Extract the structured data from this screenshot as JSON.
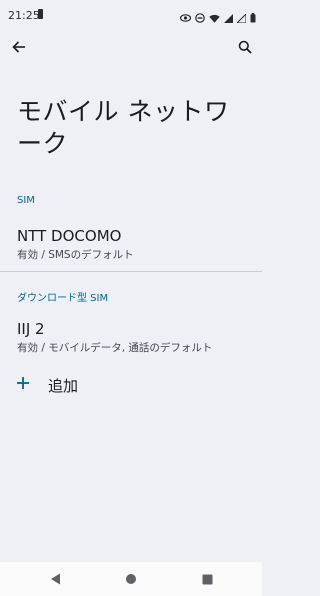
{
  "status_bar": {
    "time": "21:25"
  },
  "toolbar": {
    "back_icon": "arrow-back-icon",
    "search_icon": "search-icon"
  },
  "page": {
    "title": "モバイル ネットワーク"
  },
  "sections": {
    "sim_header": "SIM",
    "sim_item": {
      "title": "NTT DOCOMO",
      "summary": "有効 / SMSのデフォルト"
    },
    "esim_header": "ダウンロード型 SIM",
    "esim_item": {
      "title": "IIJ 2",
      "summary": "有効 / モバイルデータ, 通話のデフォルト"
    },
    "add": {
      "label": "追加",
      "icon": "plus-icon"
    }
  },
  "colors": {
    "background": "#eef0f5",
    "accent": "#00668a"
  },
  "nav_bar": {
    "back_icon": "nav-back-icon",
    "home_icon": "nav-home-icon",
    "recents_icon": "nav-recents-icon"
  }
}
